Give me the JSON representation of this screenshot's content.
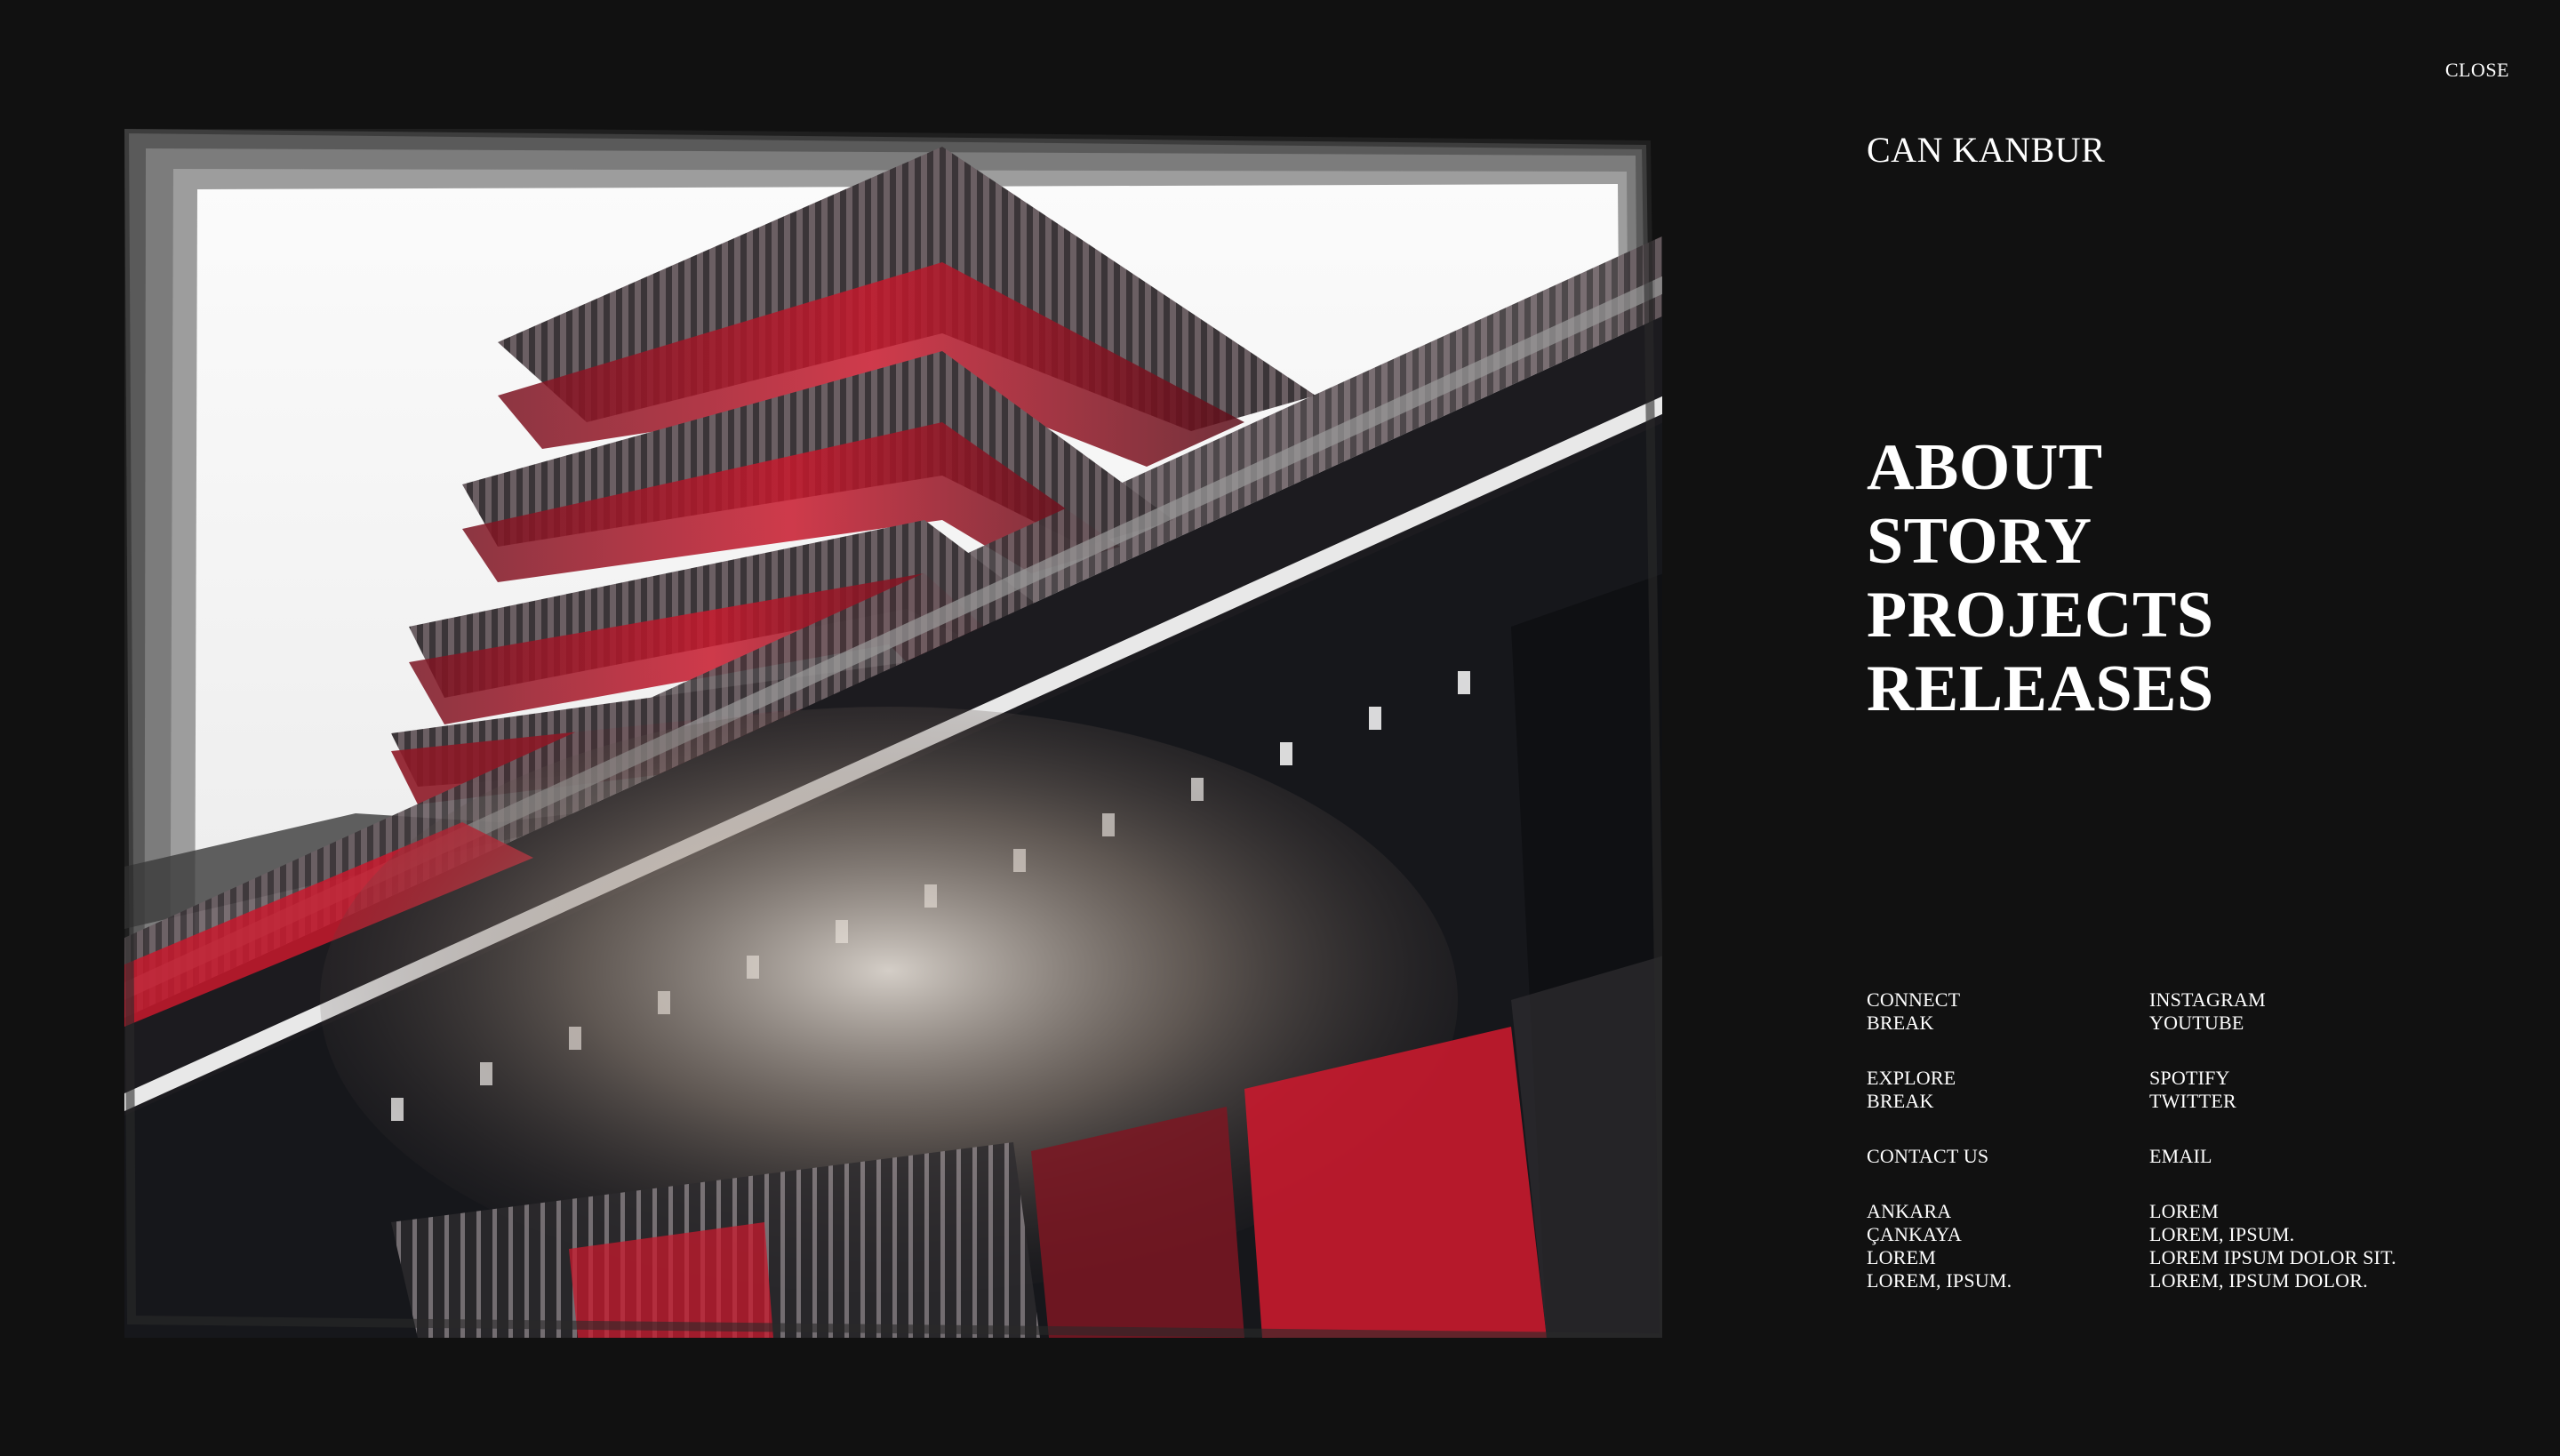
{
  "header": {
    "close_label": "CLOSE",
    "brand": "CAN KANBUR"
  },
  "nav": {
    "items": [
      "ABOUT",
      "STORY",
      "PROJECTS",
      "RELEASES"
    ]
  },
  "footer": {
    "connect": [
      "CONNECT",
      "BREAK"
    ],
    "social_1": [
      "INSTAGRAM",
      "YOUTUBE"
    ],
    "explore": [
      "EXPLORE",
      "BREAK"
    ],
    "social_2": [
      "SPOTIFY",
      "TWITTER"
    ],
    "contact": [
      "CONTACT US"
    ],
    "email": [
      "EMAIL"
    ],
    "address": [
      "ANKARA",
      "ÇANKAYA",
      "LOREM",
      "LOREM, IPSUM."
    ],
    "lorem": [
      "LOREM",
      "LOREM, IPSUM.",
      "LOREM IPSUM DOLOR SIT.",
      "LOREM, IPSUM DOLOR."
    ]
  },
  "colors": {
    "background": "#111111",
    "text": "#ffffff",
    "accent_red": "#c8192d"
  },
  "hero_image": {
    "icon": "pagoda-photo"
  }
}
